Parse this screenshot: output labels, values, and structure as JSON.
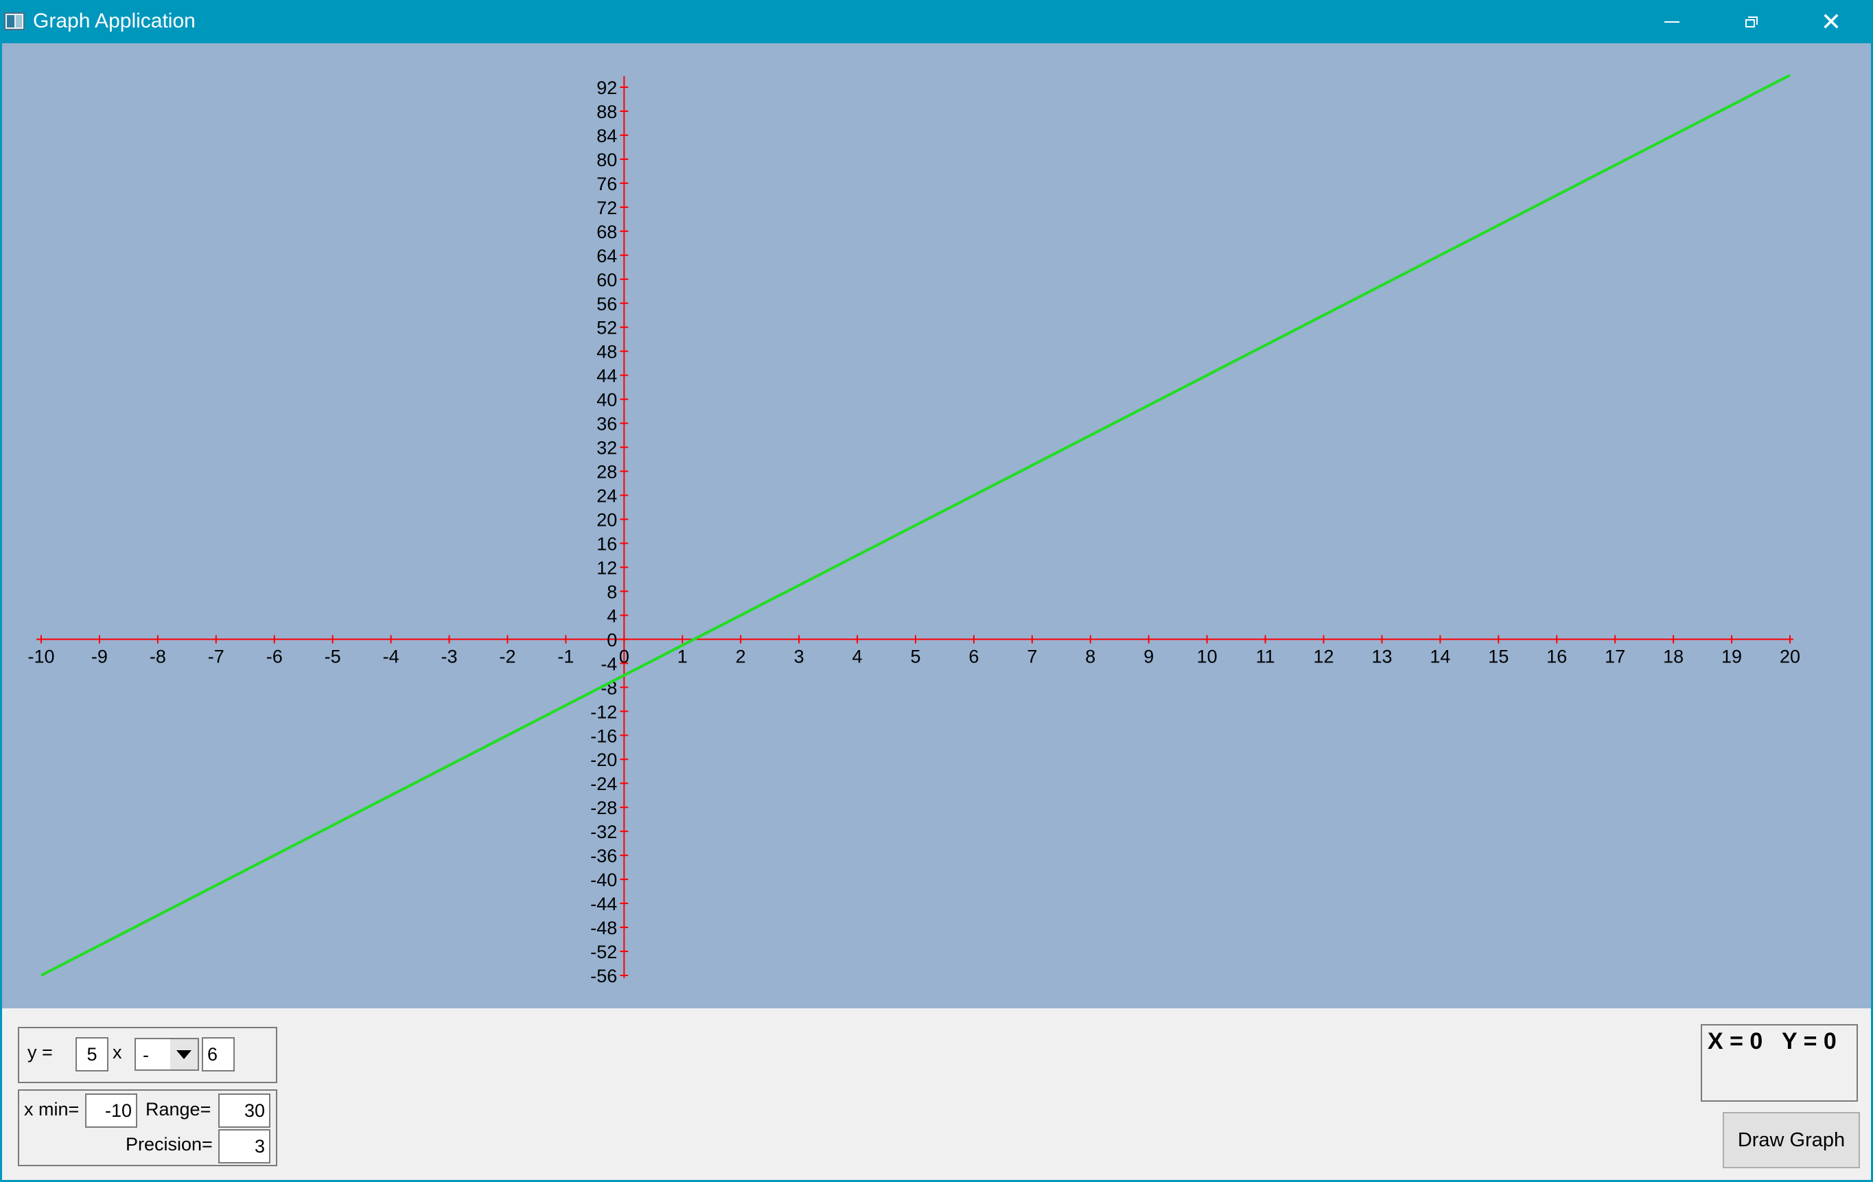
{
  "window": {
    "title": "Graph Application",
    "icons": {
      "app": "app-icon",
      "minimize": "minimize-icon",
      "maximize": "restore-icon",
      "close": "close-icon"
    },
    "close_glyph": "✕"
  },
  "colors": {
    "plot_bg": "#98b2d0",
    "axis": "#ff0000",
    "line": "#22dd22",
    "titlebar": "#0097bd"
  },
  "chart_data": {
    "type": "line",
    "x_ticks": [
      -10,
      -9,
      -8,
      -7,
      -6,
      -5,
      -4,
      -3,
      -2,
      -1,
      0,
      1,
      2,
      3,
      4,
      5,
      6,
      7,
      8,
      9,
      10,
      11,
      12,
      13,
      14,
      15,
      16,
      17,
      18,
      19,
      20
    ],
    "y_ticks": [
      92,
      88,
      84,
      80,
      76,
      72,
      68,
      64,
      60,
      56,
      52,
      48,
      44,
      40,
      36,
      32,
      28,
      24,
      20,
      16,
      12,
      8,
      4,
      0,
      -4,
      -8,
      -12,
      -16,
      -20,
      -24,
      -28,
      -32,
      -36,
      -40,
      -44,
      -48,
      -52,
      -56
    ],
    "xlim": [
      -10,
      20
    ],
    "ylim": [
      -56,
      92
    ],
    "series": [
      {
        "x": [
          -10,
          20
        ],
        "y": [
          -56,
          94
        ]
      }
    ],
    "grid": false
  },
  "equation": {
    "y_label": "y =",
    "coefficient": "5",
    "x_label": "x",
    "operator": "-",
    "constant": "6"
  },
  "range": {
    "xmin_label": "x min=",
    "xmin_value": "-10",
    "range_label": "Range=",
    "range_value": "30",
    "precision_label": "Precision=",
    "precision_value": "3"
  },
  "coords": {
    "text": "X = 0   Y = 0"
  },
  "buttons": {
    "draw": "Draw Graph"
  }
}
